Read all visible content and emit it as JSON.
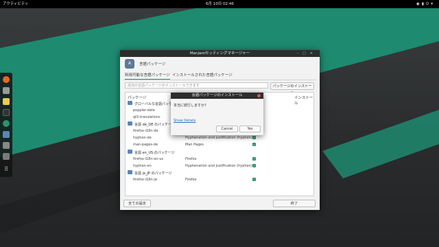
{
  "topbar": {
    "activities": "アクティビティ",
    "clock": "6月 10日  02:46"
  },
  "dock": {
    "apps": [
      "firefox-icon",
      "files-icon",
      "text-editor-icon",
      "terminal-icon",
      "software-icon",
      "settings-manager-icon",
      "disk-icon",
      "trash-icon",
      "app-grid-icon"
    ]
  },
  "window": {
    "title": "Manjaroセッティングマネージャー",
    "header_label": "言語パッケージ",
    "tabs": [
      "利用可能な言語パッケージ",
      "インストールされた言語パッケージ"
    ],
    "search_placeholder": "追加の言語パッケージがインストールできます",
    "install_button": "パッケージのインストール",
    "columns": {
      "package": "パッケージ",
      "install": "インストール"
    },
    "groups": [
      {
        "title": "グローバルな言語パッケージ",
        "rows": [
          {
            "name": "poppler-data",
            "desc": ""
          },
          {
            "name": "qt5-translations",
            "desc": ""
          }
        ]
      },
      {
        "title": "言語 de_DE のパッケージ",
        "rows": [
          {
            "name": "firefox-i18n-de",
            "desc": ""
          },
          {
            "name": "hyphen-de",
            "desc": "Hyphenation and justification (hyphen)"
          },
          {
            "name": "man-pages-de",
            "desc": "Man Pages"
          }
        ]
      },
      {
        "title": "言語 en_US のパッケージ",
        "rows": [
          {
            "name": "firefox-i18n-en-us",
            "desc": "Firefox"
          },
          {
            "name": "hyphen-en",
            "desc": "Hyphenation and justification (hyphen)"
          }
        ]
      },
      {
        "title": "言語 ja_JP のパッケージ",
        "rows": [
          {
            "name": "firefox-i18n-ja",
            "desc": "Firefox"
          }
        ]
      }
    ],
    "footer": {
      "settings_button": "全ての設定",
      "close_button": "終了"
    }
  },
  "dialog": {
    "title": "言語パッケージのインストール",
    "question": "本当に続行しますか?",
    "details_link": "Show Details",
    "cancel": "Cancel",
    "yes": "Yes"
  },
  "colors": {
    "accent": "#2f8f6f",
    "stripe": "#1f8f73"
  }
}
